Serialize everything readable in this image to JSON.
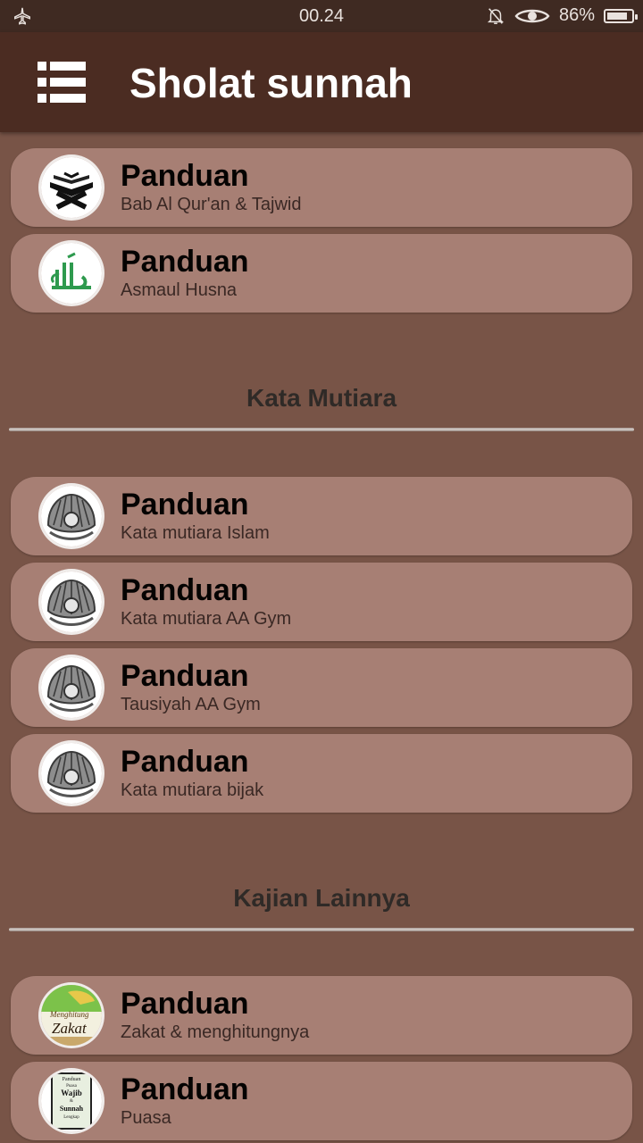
{
  "status_bar": {
    "time": "00.24",
    "battery": "86%",
    "battery_level": 0.86,
    "icons": [
      "airplane-icon",
      "bell-off-icon",
      "eye-icon",
      "battery-icon"
    ]
  },
  "app_bar": {
    "title": "Sholat sunnah",
    "menu_icon": "list-menu-icon"
  },
  "sections": [
    {
      "header": "",
      "items": [
        {
          "title": "Panduan",
          "subtitle": "Bab Al Qur'an & Tajwid",
          "icon": "quran-stand-icon"
        },
        {
          "title": "Panduan",
          "subtitle": "Asmaul Husna",
          "icon": "allah-calligraphy-icon"
        }
      ]
    },
    {
      "header": "Kata Mutiara",
      "items": [
        {
          "title": "Panduan",
          "subtitle": "Kata mutiara Islam",
          "icon": "pearl-shell-icon"
        },
        {
          "title": "Panduan",
          "subtitle": "Kata mutiara AA Gym",
          "icon": "pearl-shell-icon"
        },
        {
          "title": "Panduan",
          "subtitle": "Tausiyah AA Gym",
          "icon": "pearl-shell-icon"
        },
        {
          "title": "Panduan",
          "subtitle": "Kata mutiara bijak",
          "icon": "pearl-shell-icon"
        }
      ]
    },
    {
      "header": "Kajian Lainnya",
      "items": [
        {
          "title": "Panduan",
          "subtitle": "Zakat & menghitungnya",
          "icon": "zakat-book-icon",
          "icon_text": [
            "Menghitung",
            "Zakat"
          ]
        },
        {
          "title": "Panduan",
          "subtitle": "Puasa",
          "icon": "puasa-book-icon",
          "icon_text": [
            "Panduan",
            "Puasa",
            "Wajib",
            "&",
            "Sunnah",
            "Lengkap"
          ]
        }
      ]
    }
  ],
  "colors": {
    "background": "#785447",
    "app_bar": "#4b2c22",
    "status_bar": "#3f2a22",
    "card": "#a77f74",
    "title_text": "#ffffff"
  }
}
